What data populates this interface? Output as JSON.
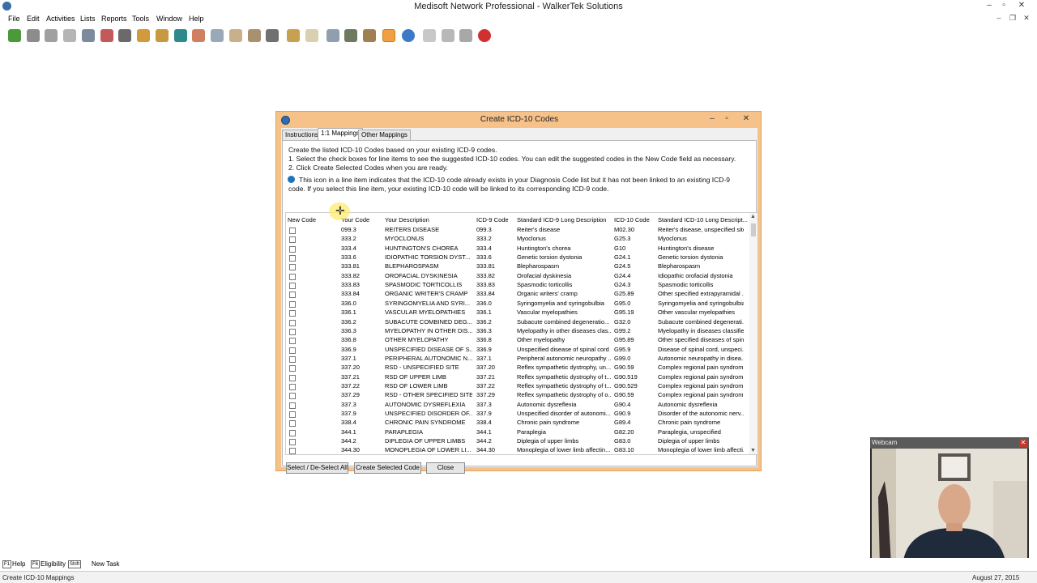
{
  "window": {
    "title": "Medisoft Network Professional - WalkerTek Solutions"
  },
  "menu": [
    "File",
    "Edit",
    "Activities",
    "Lists",
    "Reports",
    "Tools",
    "Window",
    "Help"
  ],
  "dialog": {
    "title": "Create ICD-10 Codes",
    "tabs": [
      "Instructions",
      "1:1 Mappings",
      "Other Mappings"
    ],
    "selected_tab": "1:1 Mappings",
    "instructions": [
      "Create the listed ICD-10 Codes based on your existing ICD-9 codes.",
      "1. Select the check boxes for line items to see the suggested ICD-10 codes.  You can edit the suggested codes in the New Code field as necessary.",
      "2. Click Create Selected Codes when you are ready."
    ],
    "info_line1": "This icon in a line item indicates that the ICD-10 code already exists in your Diagnosis Code list but it has not been linked to an existing ICD-9",
    "info_line2": "code.  If you select this line item, your existing ICD-10 code will be linked to its corresponding ICD-9 code.",
    "columns": [
      "New Code",
      "Your Code",
      "Your Description",
      "ICD-9 Code",
      "Standard ICD-9 Long Description",
      "ICD-10 Code",
      "Standard ICD-10 Long Descript..."
    ],
    "rows": [
      [
        "099.3",
        "REITERS DISEASE",
        "099.3",
        "Reiter's disease",
        "M02.30",
        "Reiter's disease, unspecified site"
      ],
      [
        "333.2",
        "MYOCLONUS",
        "333.2",
        "Myoclonus",
        "G25.3",
        "Myoclonus"
      ],
      [
        "333.4",
        "HUNTINGTON'S CHOREA",
        "333.4",
        "Huntington's chorea",
        "G10",
        "Huntington's disease"
      ],
      [
        "333.6",
        "IDIOPATHIC TORSION DYST...",
        "333.6",
        "Genetic torsion dystonia",
        "G24.1",
        "Genetic torsion dystonia"
      ],
      [
        "333.81",
        "BLEPHAROSPASM",
        "333.81",
        "Blepharospasm",
        "G24.5",
        "Blepharospasm"
      ],
      [
        "333.82",
        "OROFACIAL DYSKINESIA",
        "333.82",
        "Orofacial dyskinesia",
        "G24.4",
        "Idiopathic orofacial dystonia"
      ],
      [
        "333.83",
        "SPASMODIC TORTICOLLIS",
        "333.83",
        "Spasmodic torticollis",
        "G24.3",
        "Spasmodic torticollis"
      ],
      [
        "333.84",
        "ORGANIC WRITER'S CRAMP",
        "333.84",
        "Organic writers' cramp",
        "G25.89",
        "Other specified extrapyramidal ..."
      ],
      [
        "336.0",
        "SYRINGOMYELIA AND SYRI...",
        "336.0",
        "Syringomyelia and syringobulbia",
        "G95.0",
        "Syringomyelia and syringobulbia"
      ],
      [
        "336.1",
        "VASCULAR MYELOPATHIES",
        "336.1",
        "Vascular myelopathies",
        "G95.19",
        "Other vascular myelopathies"
      ],
      [
        "336.2",
        "SUBACUTE COMBINED DEG...",
        "336.2",
        "Subacute combined degeneratio...",
        "G32.0",
        "Subacute combined degenerati..."
      ],
      [
        "336.3",
        "MYELOPATHY IN OTHER DIS...",
        "336.3",
        "Myelopathy in other diseases clas...",
        "G99.2",
        "Myelopathy in diseases classifie..."
      ],
      [
        "336.8",
        "OTHER MYELOPATHY",
        "336.8",
        "Other myelopathy",
        "G95.89",
        "Other specified diseases of spin..."
      ],
      [
        "336.9",
        "UNSPECIFIED DISEASE OF S...",
        "336.9",
        "Unspecified disease of spinal cord",
        "G95.9",
        "Disease of spinal cord, unspeci..."
      ],
      [
        "337.1",
        "PERIPHERAL AUTONOMIC N...",
        "337.1",
        "Peripheral autonomic neuropathy ...",
        "G99.0",
        "Autonomic neuropathy in disea..."
      ],
      [
        "337.20",
        "RSD - UNSPECIFIED SITE",
        "337.20",
        "Reflex sympathetic dystrophy, un...",
        "G90.59",
        "Complex regional pain syndrom..."
      ],
      [
        "337.21",
        "RSD OF UPPER LIMB",
        "337.21",
        "Reflex sympathetic dystrophy of t...",
        "G90.519",
        "Complex regional pain syndrom..."
      ],
      [
        "337.22",
        "RSD OF LOWER LIMB",
        "337.22",
        "Reflex sympathetic dystrophy of t...",
        "G90.529",
        "Complex regional pain syndrom..."
      ],
      [
        "337.29",
        "RSD - OTHER SPECIFIED SITE",
        "337.29",
        "Reflex sympathetic dystrophy of o...",
        "G90.59",
        "Complex regional pain syndrom..."
      ],
      [
        "337.3",
        "AUTONOMIC DYSREFLEXIA",
        "337.3",
        "Autonomic dysreflexia",
        "G90.4",
        "Autonomic dysreflexia"
      ],
      [
        "337.9",
        "UNSPECIFIED DISORDER OF...",
        "337.9",
        "Unspecified disorder of autonomi...",
        "G90.9",
        "Disorder of the autonomic nerv..."
      ],
      [
        "338.4",
        "CHRONIC PAIN SYNDROME",
        "338.4",
        "Chronic pain syndrome",
        "G89.4",
        "Chronic pain syndrome"
      ],
      [
        "344.1",
        "PARAPLEGIA",
        "344.1",
        "Paraplegia",
        "G82.20",
        "Paraplegia, unspecified"
      ],
      [
        "344.2",
        "DIPLEGIA OF UPPER LIMBS",
        "344.2",
        "Diplegia of upper limbs",
        "G83.0",
        "Diplegia of upper limbs"
      ],
      [
        "344.30",
        "MONOPLEGIA OF LOWER LI...",
        "344.30",
        "Monoplegia of lower limb affectin...",
        "G83.10",
        "Monoplegia of lower limb affecti..."
      ]
    ],
    "buttons": {
      "select_all": "Select / De-Select All",
      "create": "Create Selected Code",
      "close": "Close"
    }
  },
  "webcam": {
    "title": "Webcam"
  },
  "taskbar": {
    "keys": [
      {
        "key": "F1",
        "label": "Help"
      },
      {
        "key": "F6",
        "label": "Eligibility"
      },
      {
        "key": "Shift",
        "label": "New Task"
      }
    ]
  },
  "status": {
    "left": "Create ICD-10 Mappings",
    "date": "August 27, 2015"
  },
  "colors": {
    "dialog_frame": "#f6c28a",
    "toolbar_active": "#f0a040",
    "info_icon": "#1e73be"
  }
}
